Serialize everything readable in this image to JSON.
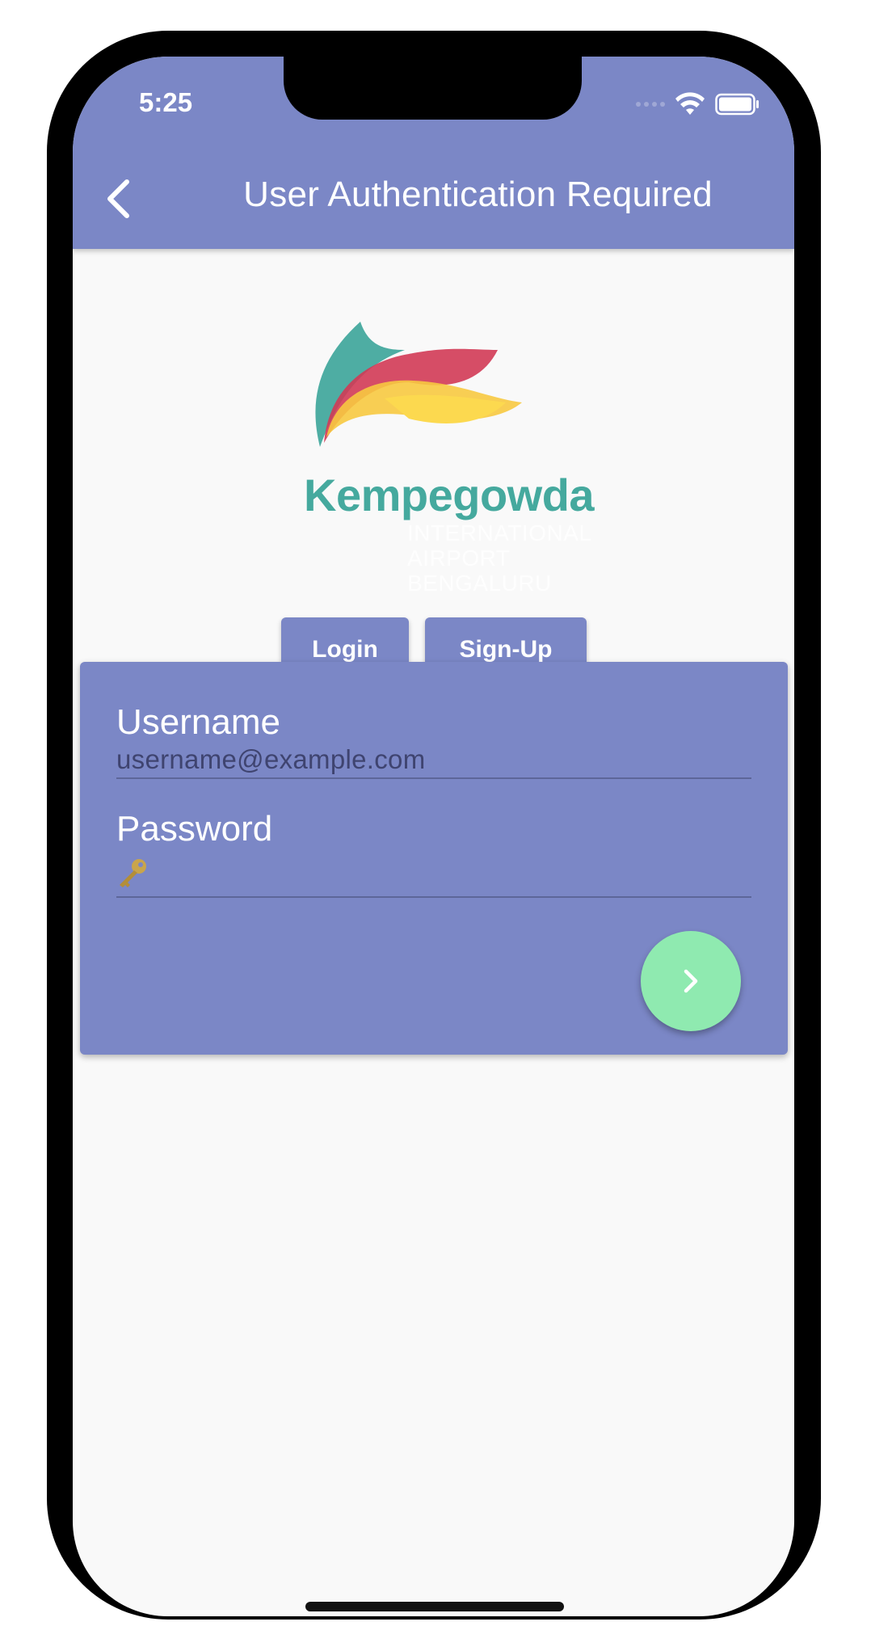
{
  "status_bar": {
    "time": "5:25",
    "icons": [
      "signal-icon",
      "wifi-icon",
      "battery-icon"
    ]
  },
  "app_bar": {
    "title": "User Authentication Required",
    "back_icon": "chevron-left-icon",
    "color": "#7b87c6"
  },
  "logo": {
    "wordmark": "Kempegowda",
    "subtitle": [
      "INTERNATIONAL",
      "AIRPORT",
      "BENGALURU"
    ],
    "colors": [
      "#45a99e",
      "#d23a55",
      "#f7c940",
      "#fcd94f"
    ]
  },
  "auth_tabs": {
    "login_label": "Login",
    "signup_label": "Sign-Up"
  },
  "form": {
    "username": {
      "label": "Username",
      "placeholder": "username@example.com"
    },
    "password": {
      "label": "Password",
      "icon": "key-icon"
    },
    "submit_icon": "chevron-right-icon",
    "accent": "#8feab0"
  }
}
